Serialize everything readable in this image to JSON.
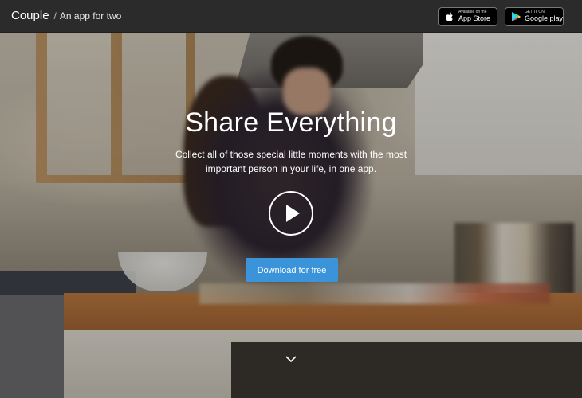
{
  "brand": {
    "name": "Couple",
    "separator": "/",
    "tagline": "An app for two"
  },
  "store_badges": {
    "apple": {
      "small": "Available on the",
      "big": "App Store",
      "icon": "apple-icon"
    },
    "google": {
      "small": "GET IT ON",
      "big": "Google play",
      "icon": "google-play-icon"
    }
  },
  "hero": {
    "headline": "Share Everything",
    "subline": "Collect all of those special little moments with the most important person in your life, in one app.",
    "cta_label": "Download for free",
    "play_icon": "play-icon",
    "scroll_icon": "chevron-down-icon"
  },
  "colors": {
    "topbar": "#2b2b2b",
    "cta": "#3b94d9",
    "text": "#ffffff"
  }
}
